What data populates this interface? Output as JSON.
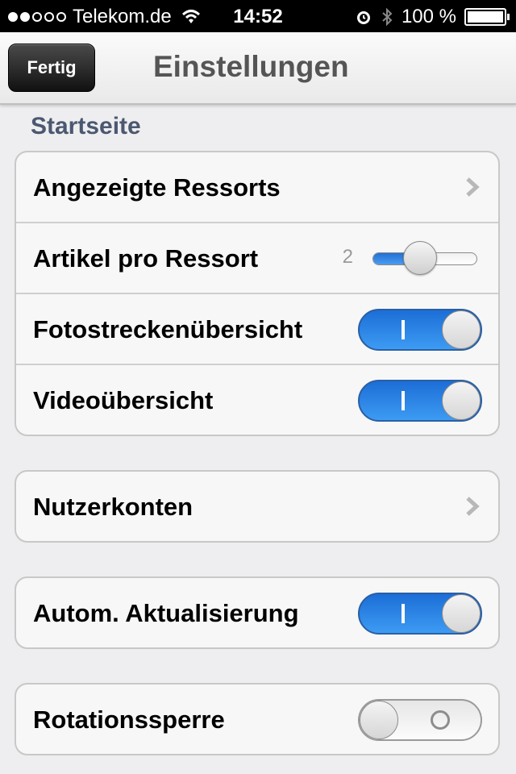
{
  "status": {
    "carrier": "Telekom.de",
    "time": "14:52",
    "battery": "100 %",
    "signal_bars": 2,
    "signal_total": 5
  },
  "nav": {
    "done_label": "Fertig",
    "title": "Einstellungen"
  },
  "section": {
    "header": "Startseite"
  },
  "rows": {
    "ressorts": "Angezeigte Ressorts",
    "artikel": "Artikel pro Ressort",
    "artikel_value": "2",
    "artikel_slider_level": 0.45,
    "foto": "Fotostreckenübersicht",
    "foto_on": true,
    "video": "Videoübersicht",
    "video_on": true,
    "konten": "Nutzerkonten",
    "autom": "Autom. Aktualisierung",
    "autom_on": true,
    "rotation": "Rotationssperre",
    "rotation_on": false
  },
  "colors": {
    "toggle_on": "#2f86e8",
    "section_header": "#4b5870",
    "background": "#eeeef0"
  }
}
